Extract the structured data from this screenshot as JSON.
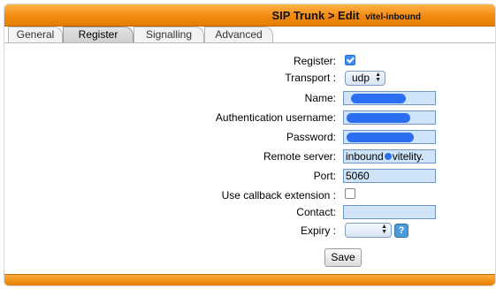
{
  "header": {
    "title": "SIP Trunk > Edit",
    "subtitle": "vitel-inbound"
  },
  "tabs": [
    {
      "label": "General",
      "active": false
    },
    {
      "label": "Register",
      "active": true
    },
    {
      "label": "Signalling",
      "active": false
    },
    {
      "label": "Advanced",
      "active": false
    }
  ],
  "form": {
    "register_label": "Register:",
    "register_checked": true,
    "transport_label": "Transport :",
    "transport_value": "udp",
    "name_label": "Name:",
    "auth_label": "Authentication username:",
    "password_label": "Password:",
    "remote_label": "Remote server:",
    "remote_value_prefix": "inbound",
    "remote_value_suffix": "vitelity.",
    "port_label": "Port:",
    "port_value": "5060",
    "callback_label": "Use callback extension :",
    "callback_checked": false,
    "contact_label": "Contact:",
    "contact_value": "",
    "expiry_label": "Expiry :",
    "expiry_value": ""
  },
  "actions": {
    "save_label": "Save"
  },
  "colors": {
    "accent": "#f28a12",
    "field_bg": "#cfe3f9",
    "redaction": "#2b6ef2"
  }
}
